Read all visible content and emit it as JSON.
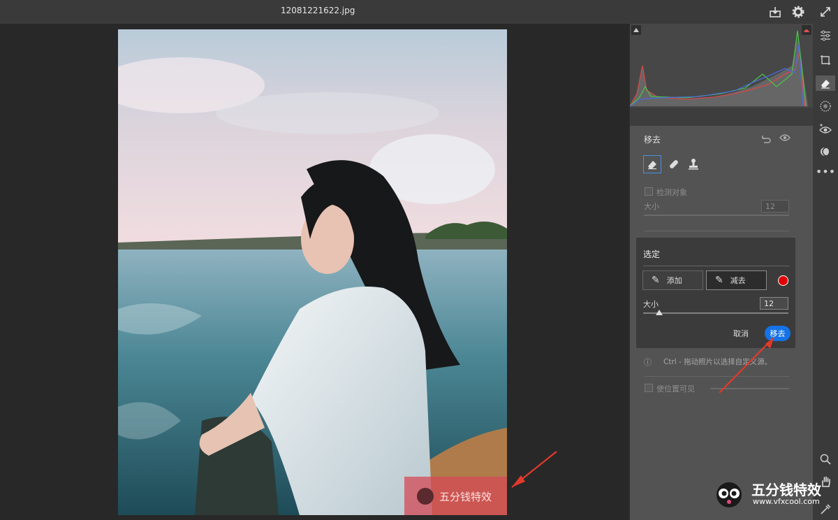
{
  "window": {
    "filename": "12081221622.jpg"
  },
  "panel": {
    "section_title": "移去",
    "detect_label": "检测对象",
    "size_label": "大小",
    "size_value": "12",
    "hint": "Ctrl - 拖动照片以选择自定义源。",
    "visible_label": "使位置可见"
  },
  "popup": {
    "title": "选定",
    "add_label": "添加",
    "subtract_label": "减去",
    "size_label": "大小",
    "size_value": "12",
    "cancel_label": "取消",
    "remove_label": "移去",
    "color_swatch": "#e00000"
  },
  "watermark": {
    "photo_text": "五分钱特效",
    "brand_text": "五分钱特效",
    "brand_url": "www.vfxcool.com"
  },
  "icons": {
    "top": [
      "download-icon",
      "gear-icon",
      "expand-icon"
    ],
    "sidebar": [
      "sliders-icon",
      "crop-icon",
      "eraser-icon",
      "mask-icon",
      "redeye-icon",
      "presets-icon",
      "more-icon",
      "zoom-icon",
      "hand-icon",
      "eyedropper-icon"
    ]
  },
  "colors": {
    "accent": "#1473e6",
    "annotation_arrow": "#e23a2a"
  }
}
